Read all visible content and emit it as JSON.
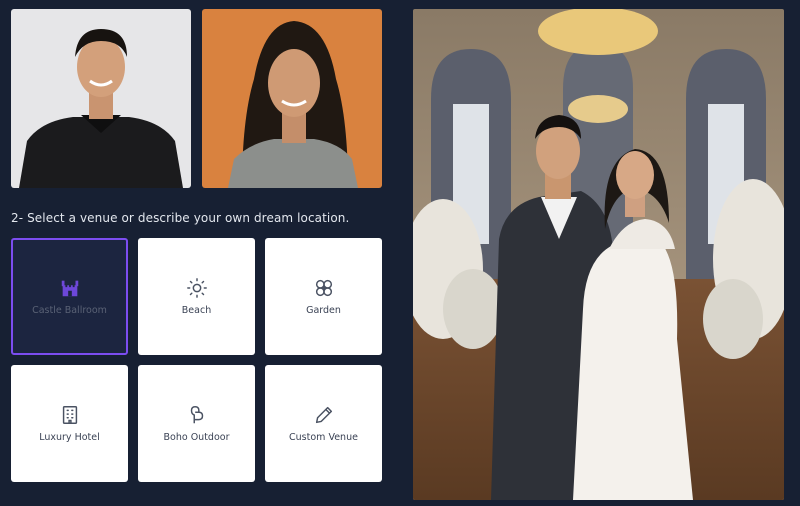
{
  "uploads": {
    "person_one_image": "portrait-man",
    "person_two_image": "portrait-woman"
  },
  "step2": {
    "prompt": "2- Select a venue or describe your own dream location."
  },
  "venues": [
    {
      "label": "Castle Ballroom",
      "icon": "castle-icon",
      "selected": true
    },
    {
      "label": "Beach",
      "icon": "sun-icon",
      "selected": false
    },
    {
      "label": "Garden",
      "icon": "flower-icon",
      "selected": false
    },
    {
      "label": "Luxury Hotel",
      "icon": "building-icon",
      "selected": false
    },
    {
      "label": "Boho Outdoor",
      "icon": "feather-icon",
      "selected": false
    },
    {
      "label": "Custom Venue",
      "icon": "pencil-icon",
      "selected": false
    }
  ],
  "result": {
    "image": "wedding-portrait-ballroom"
  },
  "colors": {
    "background": "#172033",
    "accent": "#7c4df0",
    "tile": "#ffffff",
    "selected_tile": "#1c2540"
  }
}
